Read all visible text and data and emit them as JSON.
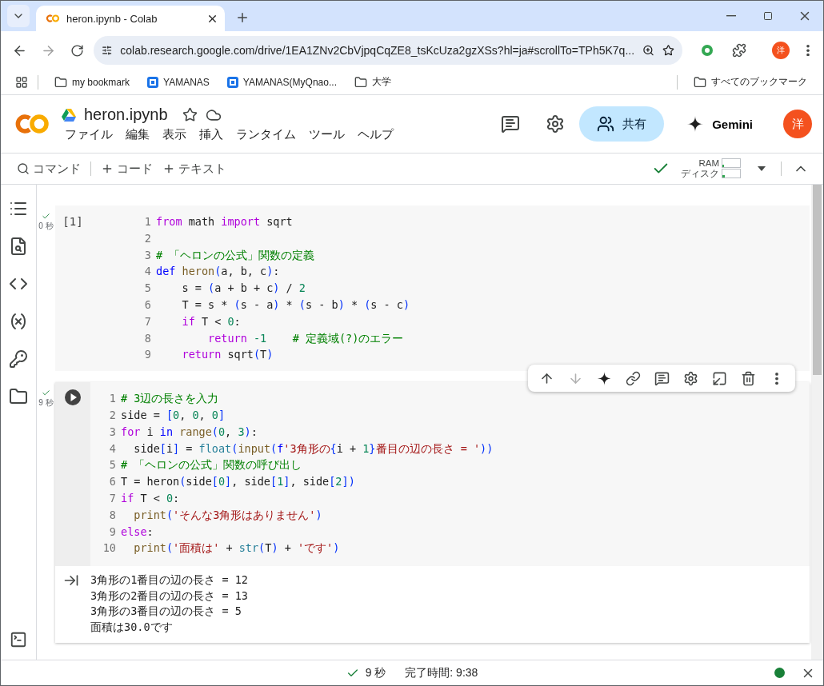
{
  "browser": {
    "tabs": [
      {
        "title": "heron.ipynb - Colab",
        "selected": true
      }
    ],
    "url": "colab.research.google.com/drive/1EA1ZNv2CbVjpqCqZE8_tsKcUza2gzXSs?hl=ja#scrollTo=TPh5K7q...",
    "profile": "洋",
    "bookmarks": [
      {
        "kind": "folder",
        "label": "my bookmark"
      },
      {
        "kind": "site",
        "label": "YAMANAS"
      },
      {
        "kind": "site",
        "label": "YAMANAS(MyQnao..."
      },
      {
        "kind": "folder",
        "label": "大学"
      }
    ],
    "all_bookmarks": "すべてのブックマーク"
  },
  "notebook": {
    "title": "heron.ipynb",
    "menu": [
      "ファイル",
      "編集",
      "表示",
      "挿入",
      "ランタイム",
      "ツール",
      "ヘルプ"
    ],
    "share": "共有",
    "gemini": "Gemini",
    "avatar": "洋"
  },
  "toolbar": {
    "command": "コマンド",
    "add_code": "コード",
    "add_text": "テキスト",
    "connected": true,
    "meters": [
      {
        "label": "RAM",
        "level": 0.1
      },
      {
        "label": "ディスク",
        "level": 0.15
      }
    ]
  },
  "cells": [
    {
      "kind": "code",
      "focused": false,
      "exec_label": "[1]",
      "done": true,
      "time": "0 秒",
      "lines": [
        {
          "number": "1",
          "tokens": [
            {
              "kind": "kw",
              "text": "from"
            },
            {
              "kind": "p",
              "text": " math "
            },
            {
              "kind": "kw",
              "text": "import"
            },
            {
              "kind": "p",
              "text": " sqrt"
            }
          ]
        },
        {
          "number": "2"
        },
        {
          "number": "3",
          "tokens": [
            {
              "kind": "com",
              "text": "# 「ヘロンの公式」関数の定義"
            }
          ]
        },
        {
          "number": "4",
          "tokens": [
            {
              "kind": "def",
              "text": "def"
            },
            {
              "kind": "fn",
              "text": " heron"
            },
            {
              "kind": "br",
              "text": "("
            },
            {
              "kind": "p",
              "text": "a, b, c"
            },
            {
              "kind": "br",
              "text": ")"
            },
            {
              "kind": "p",
              "text": ":"
            }
          ]
        },
        {
          "number": "5",
          "tokens": [
            {
              "kind": "p",
              "text": "    s = "
            },
            {
              "kind": "br",
              "text": "("
            },
            {
              "kind": "p",
              "text": "a + b + c"
            },
            {
              "kind": "br",
              "text": ")"
            },
            {
              "kind": "p",
              "text": " / "
            },
            {
              "kind": "num",
              "text": "2"
            }
          ]
        },
        {
          "number": "6",
          "tokens": [
            {
              "kind": "p",
              "text": "    T = s * "
            },
            {
              "kind": "br",
              "text": "("
            },
            {
              "kind": "p",
              "text": "s - a"
            },
            {
              "kind": "br",
              "text": ")"
            },
            {
              "kind": "p",
              "text": " * "
            },
            {
              "kind": "br",
              "text": "("
            },
            {
              "kind": "p",
              "text": "s - b"
            },
            {
              "kind": "br",
              "text": ")"
            },
            {
              "kind": "p",
              "text": " * "
            },
            {
              "kind": "br",
              "text": "("
            },
            {
              "kind": "p",
              "text": "s - c"
            },
            {
              "kind": "br",
              "text": ")"
            }
          ]
        },
        {
          "number": "7",
          "tokens": [
            {
              "kind": "kw",
              "text": "    if"
            },
            {
              "kind": "p",
              "text": " T < "
            },
            {
              "kind": "num",
              "text": "0"
            },
            {
              "kind": "p",
              "text": ":"
            }
          ]
        },
        {
          "number": "8",
          "tokens": [
            {
              "kind": "kw",
              "text": "        return"
            },
            {
              "kind": "num",
              "text": " -1"
            },
            {
              "kind": "com",
              "text": "    # 定義域(?)のエラー"
            }
          ]
        },
        {
          "number": "9",
          "tokens": [
            {
              "kind": "kw",
              "text": "    return"
            },
            {
              "kind": "p",
              "text": " sqrt"
            },
            {
              "kind": "br",
              "text": "("
            },
            {
              "kind": "p",
              "text": "T"
            },
            {
              "kind": "br",
              "text": ")"
            }
          ]
        }
      ]
    },
    {
      "kind": "code",
      "focused": true,
      "done": true,
      "time": "9 秒",
      "lines": [
        {
          "number": "1",
          "tokens": [
            {
              "kind": "com",
              "text": "# 3辺の長さを入力"
            }
          ]
        },
        {
          "number": "2",
          "tokens": [
            {
              "kind": "p",
              "text": "side = "
            },
            {
              "kind": "br",
              "text": "["
            },
            {
              "kind": "num",
              "text": "0"
            },
            {
              "kind": "p",
              "text": ", "
            },
            {
              "kind": "num",
              "text": "0"
            },
            {
              "kind": "p",
              "text": ", "
            },
            {
              "kind": "num",
              "text": "0"
            },
            {
              "kind": "br",
              "text": "]"
            }
          ]
        },
        {
          "number": "3",
          "tokens": [
            {
              "kind": "kw",
              "text": "for"
            },
            {
              "kind": "p",
              "text": " i "
            },
            {
              "kind": "def",
              "text": "in"
            },
            {
              "kind": "fn",
              "text": " range"
            },
            {
              "kind": "br",
              "text": "("
            },
            {
              "kind": "num",
              "text": "0"
            },
            {
              "kind": "p",
              "text": ", "
            },
            {
              "kind": "num",
              "text": "3"
            },
            {
              "kind": "br",
              "text": ")"
            },
            {
              "kind": "p",
              "text": ":"
            }
          ]
        },
        {
          "number": "4",
          "tokens": [
            {
              "kind": "p",
              "text": "  side"
            },
            {
              "kind": "br",
              "text": "["
            },
            {
              "kind": "p",
              "text": "i"
            },
            {
              "kind": "br",
              "text": "]"
            },
            {
              "kind": "p",
              "text": " = "
            },
            {
              "kind": "bi",
              "text": "float"
            },
            {
              "kind": "br",
              "text": "("
            },
            {
              "kind": "fn",
              "text": "input"
            },
            {
              "kind": "br",
              "text": "("
            },
            {
              "kind": "def",
              "text": "f"
            },
            {
              "kind": "str",
              "text": "'3角形の"
            },
            {
              "kind": "br",
              "text": "{"
            },
            {
              "kind": "p",
              "text": "i + "
            },
            {
              "kind": "num",
              "text": "1"
            },
            {
              "kind": "br",
              "text": "}"
            },
            {
              "kind": "str",
              "text": "番目の辺の長さ = '"
            },
            {
              "kind": "br",
              "text": "))"
            }
          ]
        },
        {
          "number": "5",
          "tokens": [
            {
              "kind": "com",
              "text": "# 「ヘロンの公式」関数の呼び出し"
            }
          ]
        },
        {
          "number": "6",
          "tokens": [
            {
              "kind": "p",
              "text": "T = heron"
            },
            {
              "kind": "br",
              "text": "("
            },
            {
              "kind": "p",
              "text": "side"
            },
            {
              "kind": "br",
              "text": "["
            },
            {
              "kind": "num",
              "text": "0"
            },
            {
              "kind": "br",
              "text": "]"
            },
            {
              "kind": "p",
              "text": ", side"
            },
            {
              "kind": "br",
              "text": "["
            },
            {
              "kind": "num",
              "text": "1"
            },
            {
              "kind": "br",
              "text": "]"
            },
            {
              "kind": "p",
              "text": ", side"
            },
            {
              "kind": "br",
              "text": "["
            },
            {
              "kind": "num",
              "text": "2"
            },
            {
              "kind": "br",
              "text": "])"
            }
          ]
        },
        {
          "number": "7",
          "tokens": [
            {
              "kind": "kw",
              "text": "if"
            },
            {
              "kind": "p",
              "text": " T < "
            },
            {
              "kind": "num",
              "text": "0"
            },
            {
              "kind": "p",
              "text": ":"
            }
          ]
        },
        {
          "number": "8",
          "tokens": [
            {
              "kind": "fn",
              "text": "  print"
            },
            {
              "kind": "br",
              "text": "("
            },
            {
              "kind": "str",
              "text": "'そんな3角形はありません'"
            },
            {
              "kind": "br",
              "text": ")"
            }
          ]
        },
        {
          "number": "9",
          "tokens": [
            {
              "kind": "kw",
              "text": "else"
            },
            {
              "kind": "p",
              "text": ":"
            }
          ]
        },
        {
          "number": "10",
          "tokens": [
            {
              "kind": "fn",
              "text": "  print"
            },
            {
              "kind": "br",
              "text": "("
            },
            {
              "kind": "str",
              "text": "'面積は'"
            },
            {
              "kind": "p",
              "text": " + "
            },
            {
              "kind": "bi",
              "text": "str"
            },
            {
              "kind": "br",
              "text": "("
            },
            {
              "kind": "p",
              "text": "T"
            },
            {
              "kind": "br",
              "text": ")"
            },
            {
              "kind": "p",
              "text": " + "
            },
            {
              "kind": "str",
              "text": "'です'"
            },
            {
              "kind": "br",
              "text": ")"
            }
          ]
        }
      ],
      "output": [
        "3角形の1番目の辺の長さ = 12",
        "3角形の2番目の辺の長さ = 13",
        "3角形の3番目の辺の長さ = 5",
        "面積は30.0です"
      ]
    }
  ],
  "status_bar": {
    "done": true,
    "time": "9 秒",
    "completed": "完了時間: 9:38",
    "connected": true
  }
}
